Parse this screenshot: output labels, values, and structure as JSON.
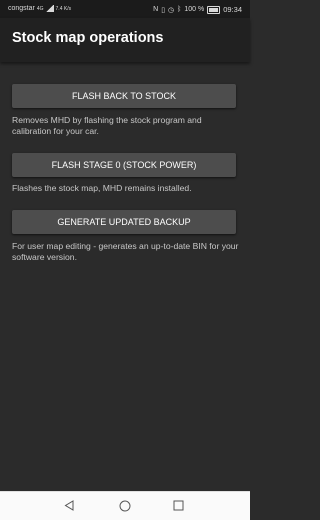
{
  "status_bar": {
    "carrier": "congstar",
    "network_type": "4G",
    "data_rate": "7.4 K/s",
    "battery": "100 %",
    "time": "09:34"
  },
  "app_bar": {
    "title": "Stock map operations"
  },
  "actions": [
    {
      "label": "FLASH BACK TO STOCK",
      "description": "Removes MHD by flashing the stock program and calibration for your car."
    },
    {
      "label": "FLASH STAGE 0 (STOCK POWER)",
      "description": "Flashes the stock map, MHD remains installed."
    },
    {
      "label": "GENERATE UPDATED BACKUP",
      "description": "For user map editing - generates an up-to-date BIN for your software version."
    }
  ],
  "nav_bar": {
    "icons": [
      "back-icon",
      "home-icon",
      "recents-icon"
    ]
  },
  "colors": {
    "background": "#2b2b2b",
    "app_bar": "#212121",
    "button": "#4d4d4d",
    "description_text": "#c8c8c8",
    "nav_bar": "#fafafa"
  }
}
